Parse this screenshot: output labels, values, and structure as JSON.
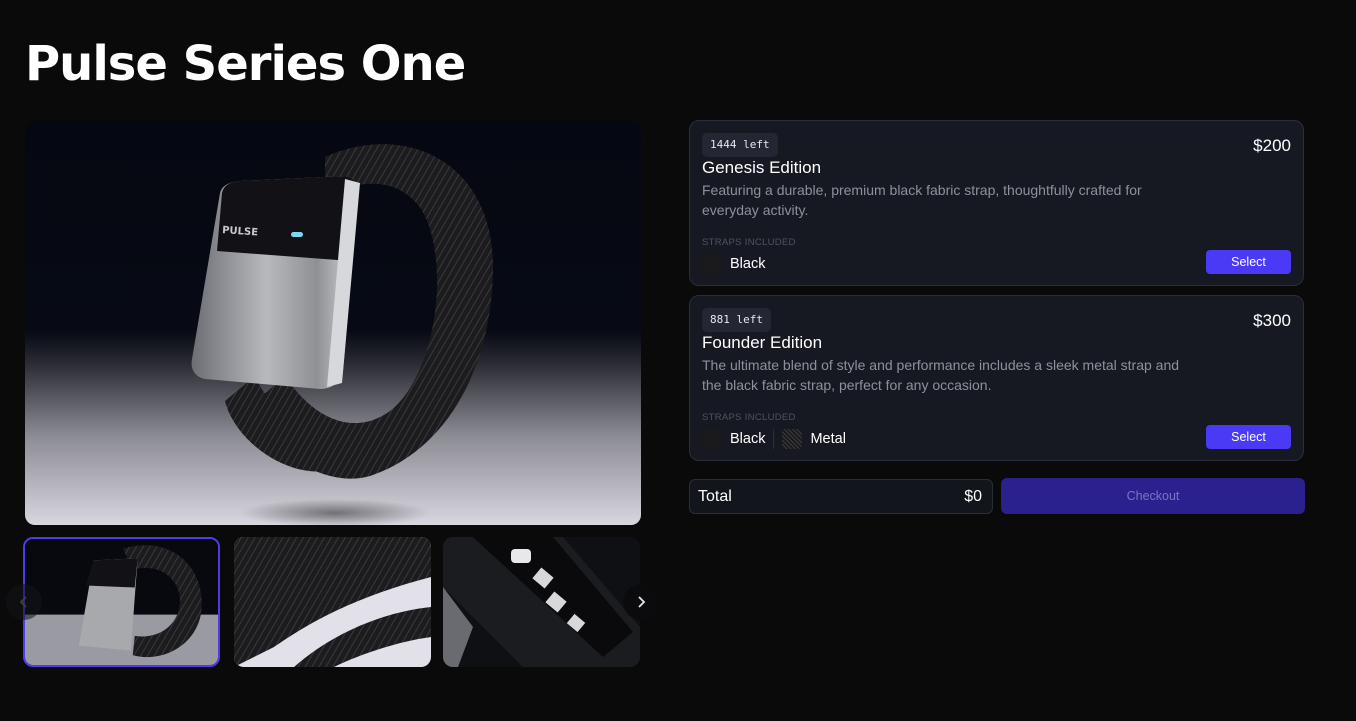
{
  "page": {
    "title": "Pulse Series One"
  },
  "gallery": {
    "hero_alt": "Pulse wristband",
    "brand_text": "PULSE",
    "thumbnails": [
      "Wristband front",
      "Mesh strap close-up",
      "Sensor underside"
    ],
    "prev_icon": "chevron-left-icon",
    "next_icon": "chevron-right-icon"
  },
  "straps_label": "STRAPS INCLUDED",
  "editions": [
    {
      "stock": "1444 left",
      "name": "Genesis Edition",
      "price": "$200",
      "description": "Featuring a durable, premium black fabric strap, thoughtfully crafted for everyday activity.",
      "straps": [
        "Black"
      ],
      "select_label": "Select"
    },
    {
      "stock": "881 left",
      "name": "Founder Edition",
      "price": "$300",
      "description": "The ultimate blend of style and performance includes a sleek metal strap and the black fabric strap, perfect for any occasion.",
      "straps": [
        "Black",
        "Metal"
      ],
      "select_label": "Select"
    }
  ],
  "summary": {
    "total_label": "Total",
    "total_value": "$0",
    "checkout_label": "Checkout"
  },
  "colors": {
    "accent": "#4a3af6",
    "checkout_bg": "#2a218f",
    "card_bg": "#171922"
  }
}
